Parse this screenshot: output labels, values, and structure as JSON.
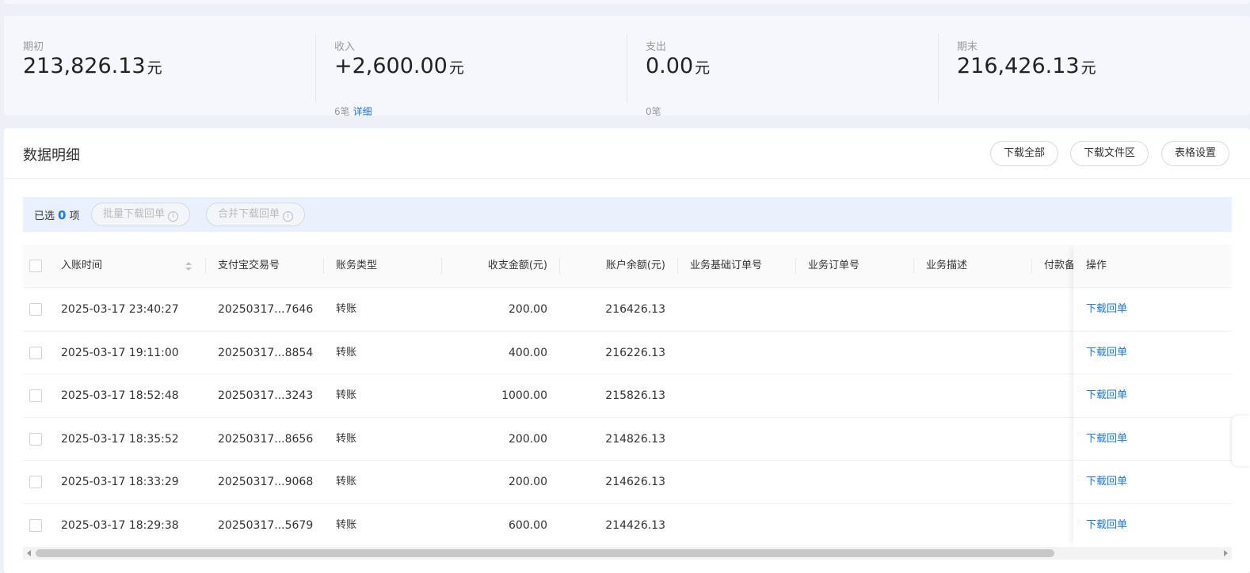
{
  "summary": {
    "opening": {
      "label": "期初",
      "value": "213,826.13",
      "unit": "元"
    },
    "income": {
      "label": "收入",
      "value": "+2,600.00",
      "unit": "元",
      "count": "6笔",
      "detail_link": "详细"
    },
    "expense": {
      "label": "支出",
      "value": "0.00",
      "unit": "元",
      "count": "0笔"
    },
    "closing": {
      "label": "期末",
      "value": "216,426.13",
      "unit": "元"
    }
  },
  "detail": {
    "title": "数据明细",
    "buttons": {
      "download_all": "下载全部",
      "download_area": "下载文件区",
      "table_settings": "表格设置"
    }
  },
  "selection": {
    "prefix": "已选",
    "count": "0",
    "suffix": "项",
    "batch_download": "批量下载回单",
    "merge_download": "合并下载回单",
    "info_glyph": "i"
  },
  "table": {
    "columns": {
      "time": "入账时间",
      "trade_no": "支付宝交易号",
      "type": "账务类型",
      "amount": "收支金额(元)",
      "balance": "账户余额(元)",
      "base_order": "业务基础订单号",
      "order": "业务订单号",
      "desc": "业务描述",
      "remark": "付款备",
      "action": "操作"
    },
    "rows": [
      {
        "time": "2025-03-17 23:40:27",
        "trade_no": "20250317...7646",
        "type": "转账",
        "amount": "200.00",
        "balance": "216426.13",
        "action": "下载回单"
      },
      {
        "time": "2025-03-17 19:11:00",
        "trade_no": "20250317...8854",
        "type": "转账",
        "amount": "400.00",
        "balance": "216226.13",
        "action": "下载回单"
      },
      {
        "time": "2025-03-17 18:52:48",
        "trade_no": "20250317...3243",
        "type": "转账",
        "amount": "1000.00",
        "balance": "215826.13",
        "action": "下载回单"
      },
      {
        "time": "2025-03-17 18:35:52",
        "trade_no": "20250317...8656",
        "type": "转账",
        "amount": "200.00",
        "balance": "214826.13",
        "action": "下载回单"
      },
      {
        "time": "2025-03-17 18:33:29",
        "trade_no": "20250317...9068",
        "type": "转账",
        "amount": "200.00",
        "balance": "214626.13",
        "action": "下载回单"
      },
      {
        "time": "2025-03-17 18:29:38",
        "trade_no": "20250317...5679",
        "type": "转账",
        "amount": "600.00",
        "balance": "214426.13",
        "action": "下载回单"
      }
    ]
  },
  "colors": {
    "accent": "#1677ff",
    "page_bg": "#eef0f7",
    "card_bg": "#f5f7fc",
    "select_bar": "#eaf1fc"
  },
  "icons": {
    "sort": "sort-icon",
    "info": "info-icon",
    "checkbox": "checkbox-icon"
  }
}
